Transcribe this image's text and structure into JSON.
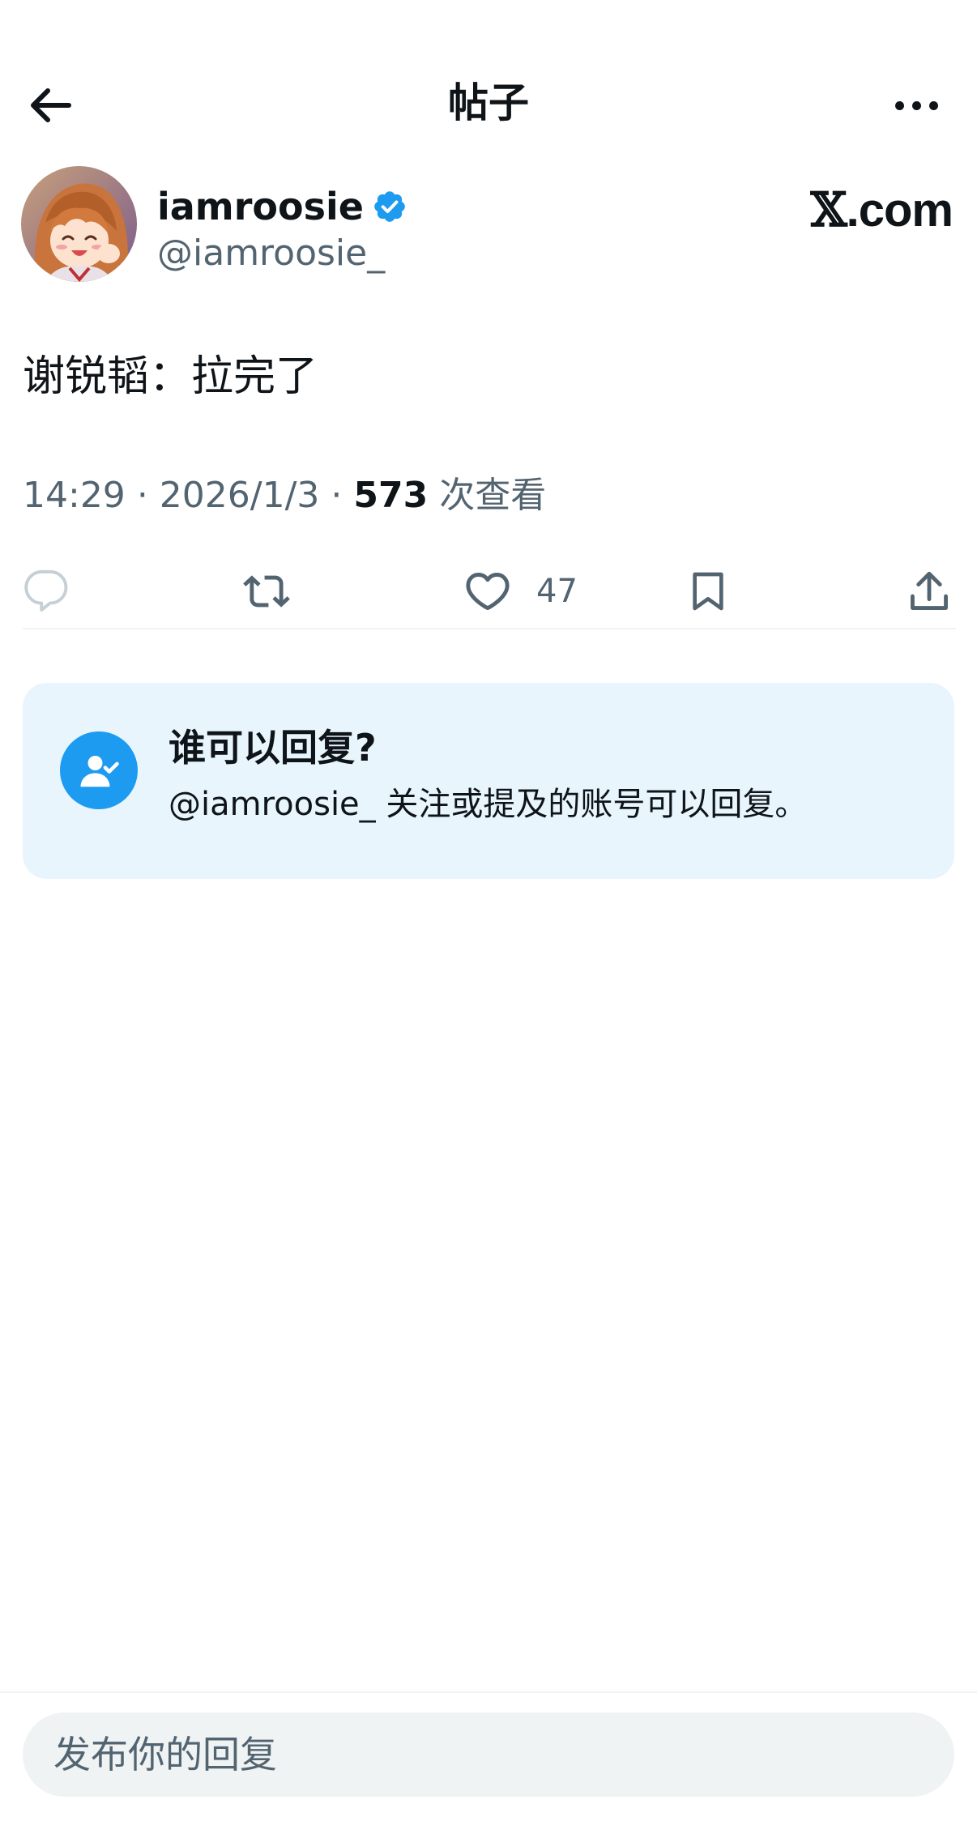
{
  "header": {
    "title": "帖子",
    "back_icon": "arrow-left-icon",
    "more_icon": "more-horizontal-icon"
  },
  "author": {
    "display_name": "iamroosie",
    "handle": "@iamroosie_",
    "verified": true,
    "verified_color": "#1d9bf0"
  },
  "brand": {
    "x_letter": "𝕏",
    "domain": ".com"
  },
  "post": {
    "text": "谢锐韬：拉完了",
    "time": "14:29",
    "date": "2026/1/3",
    "views": "573",
    "views_label": "次查看"
  },
  "actions": {
    "reply_icon": "reply-icon",
    "repost_icon": "repost-icon",
    "like_icon": "like-icon",
    "like_count": "47",
    "bookmark_icon": "bookmark-icon",
    "share_icon": "share-icon"
  },
  "reply_restriction": {
    "title": "谁可以回复?",
    "description": "@iamroosie_ 关注或提及的账号可以回复。",
    "icon": "user-check-icon"
  },
  "compose": {
    "placeholder": "发布你的回复"
  },
  "colors": {
    "accent": "#1d9bf0",
    "secondary_text": "#536471",
    "card_background": "#e8f5fd"
  }
}
